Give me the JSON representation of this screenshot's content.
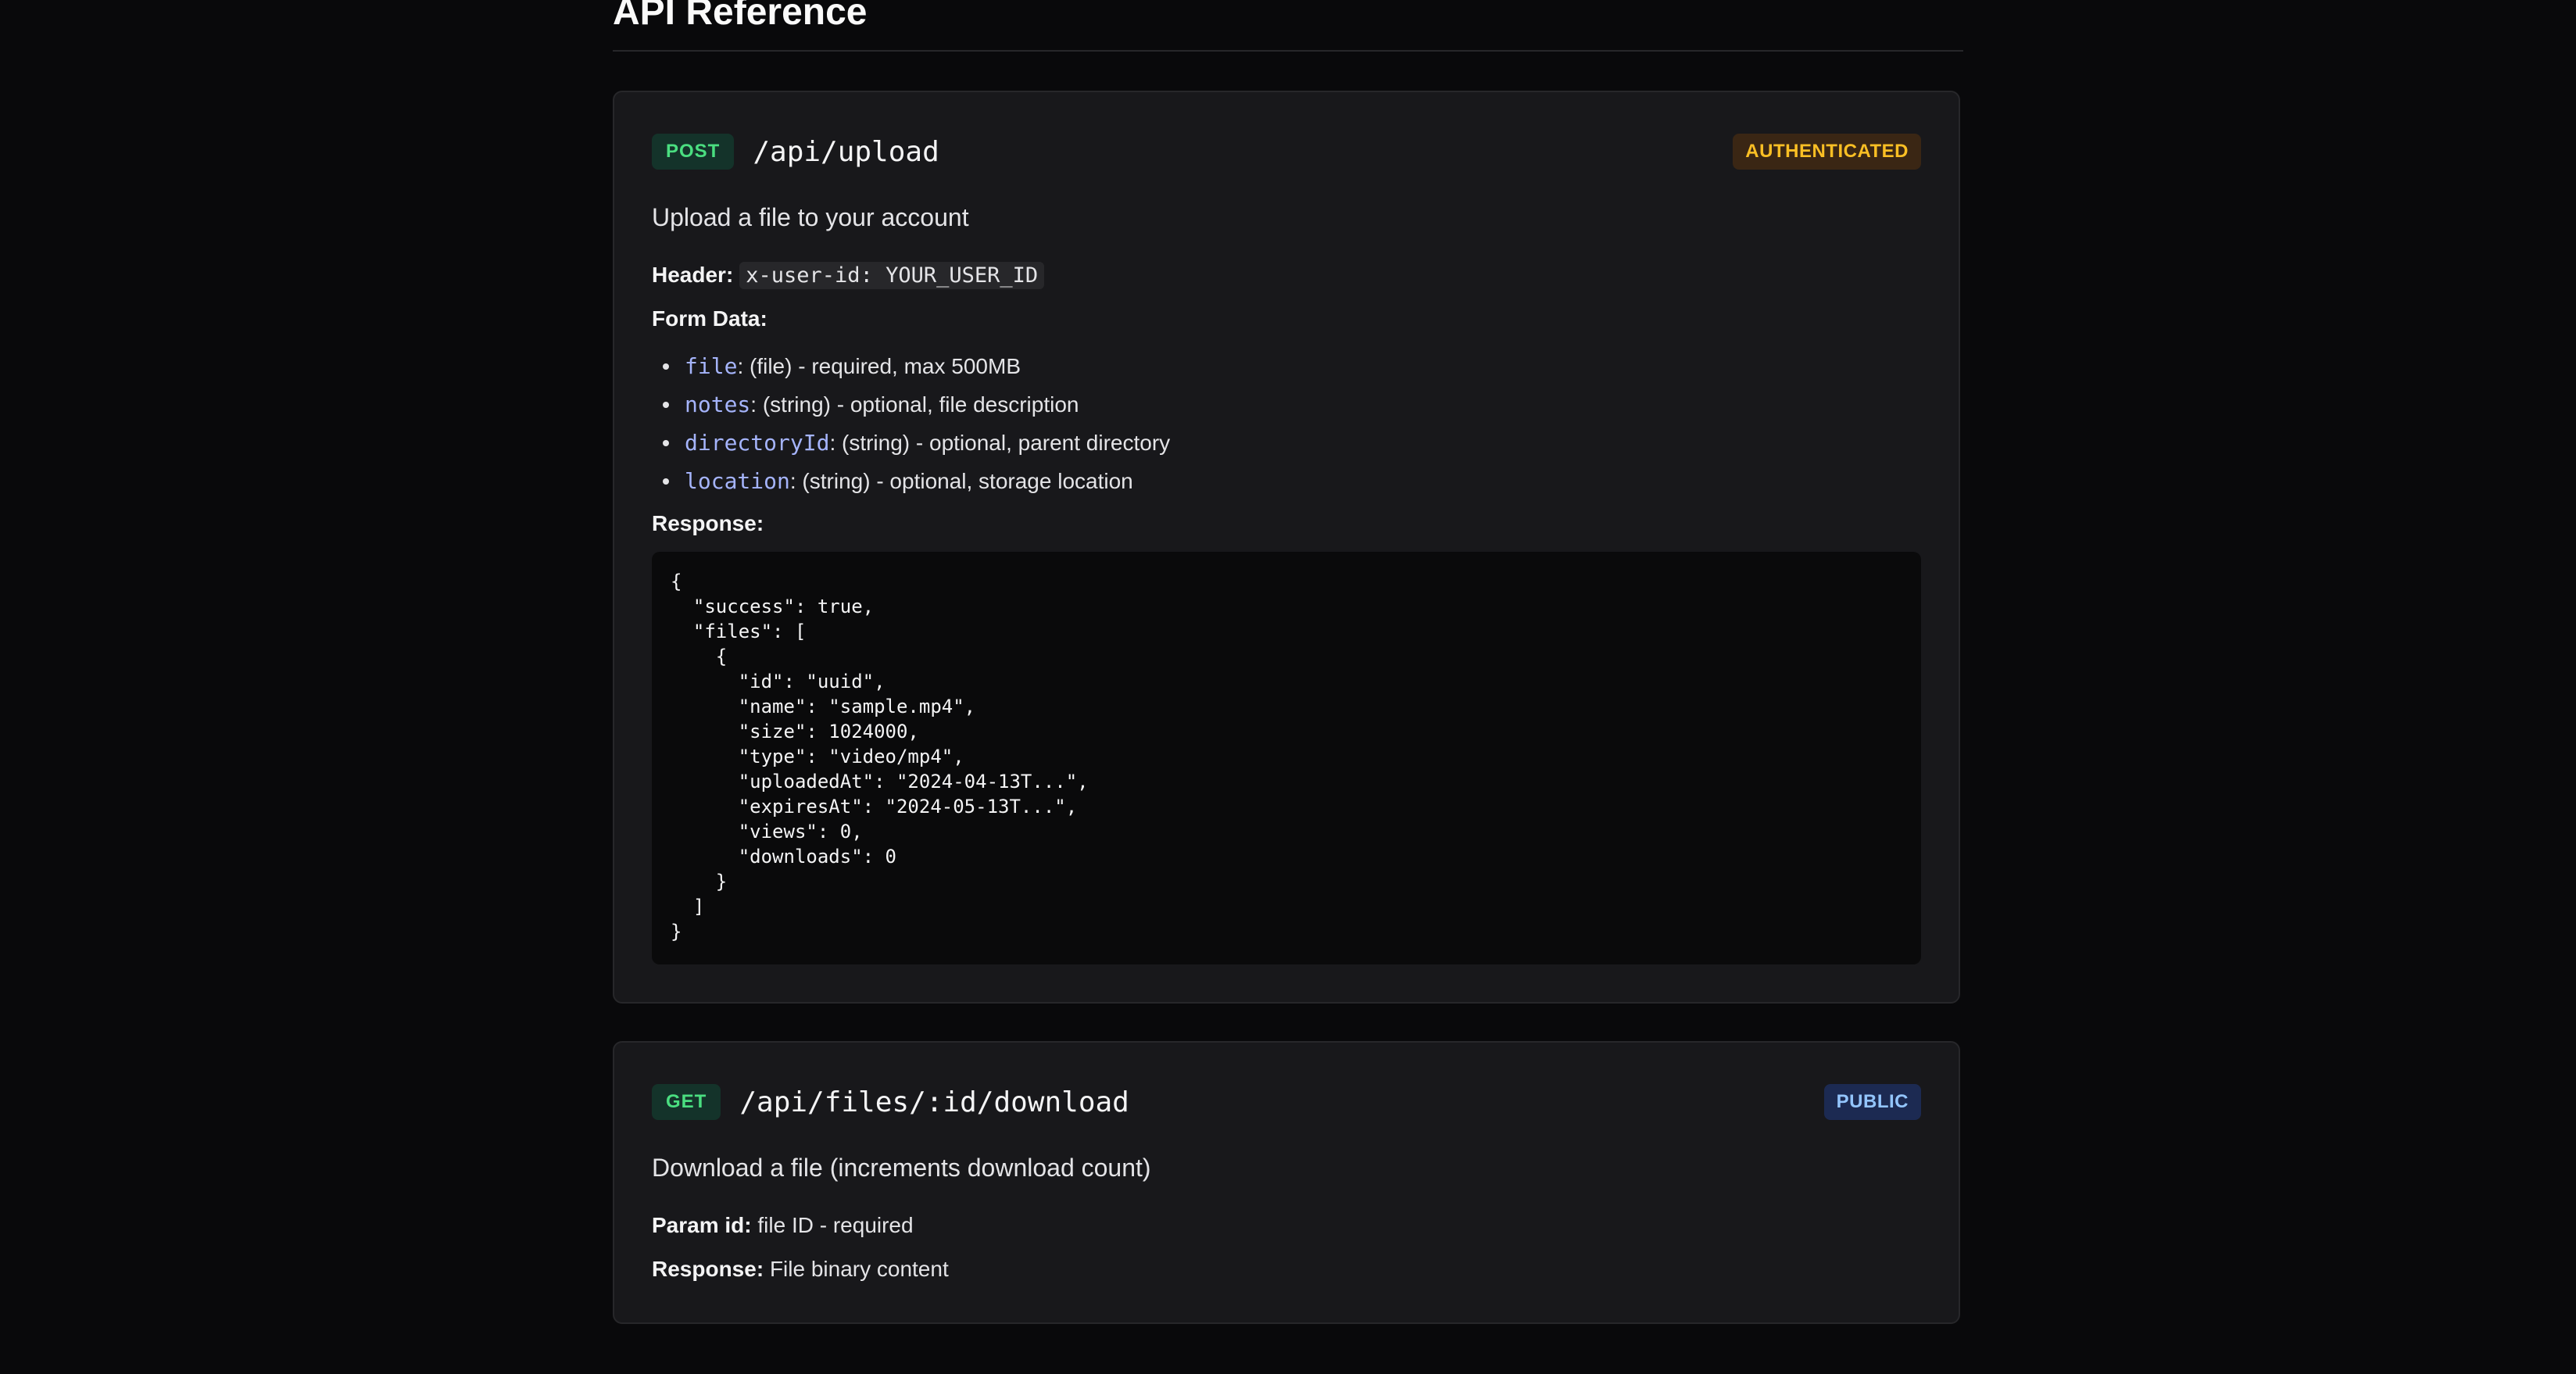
{
  "page": {
    "title": "API Reference"
  },
  "endpoints": [
    {
      "method": "POST",
      "path": "/api/upload",
      "access": "AUTHENTICATED",
      "description": "Upload a file to your account",
      "header_label": "Header:",
      "header_value": "x-user-id: YOUR_USER_ID",
      "form_label": "Form Data:",
      "fields": [
        {
          "name": "file",
          "desc": ": (file) - required, max 500MB"
        },
        {
          "name": "notes",
          "desc": ": (string) - optional, file description"
        },
        {
          "name": "directoryId",
          "desc": ": (string) - optional, parent directory"
        },
        {
          "name": "location",
          "desc": ": (string) - optional, storage location"
        }
      ],
      "response_label": "Response:",
      "response_code": "{\n  \"success\": true,\n  \"files\": [\n    {\n      \"id\": \"uuid\",\n      \"name\": \"sample.mp4\",\n      \"size\": 1024000,\n      \"type\": \"video/mp4\",\n      \"uploadedAt\": \"2024-04-13T...\",\n      \"expiresAt\": \"2024-05-13T...\",\n      \"views\": 0,\n      \"downloads\": 0\n    }\n  ]\n}"
    },
    {
      "method": "GET",
      "path": "/api/files/:id/download",
      "access": "PUBLIC",
      "description": "Download a file (increments download count)",
      "param_label": "Param id:",
      "param_value": "file ID - required",
      "response_label": "Response:",
      "response_value": "File binary content"
    }
  ],
  "colors": {
    "background": "#09090b",
    "card": "#18181b",
    "method_badge": "#4ade80",
    "authenticated_badge": "#fbbf24",
    "public_badge": "#93c5fd",
    "field_name": "#a5b4fc"
  }
}
